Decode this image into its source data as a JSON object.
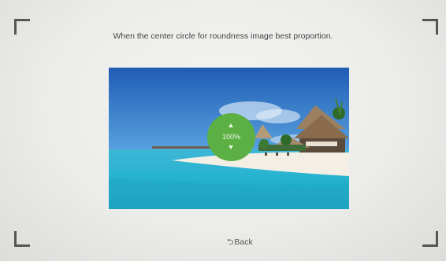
{
  "instruction": "When the center circle for roundness image best proportion.",
  "zoom": {
    "value_label": "100%",
    "up_icon": "triangle-up-icon",
    "down_icon": "triangle-down-icon"
  },
  "back": {
    "label": "Back",
    "icon": "return-arrow-icon"
  },
  "colors": {
    "circle": "#5cb043",
    "frame": "#555555",
    "background": "#ececea"
  }
}
